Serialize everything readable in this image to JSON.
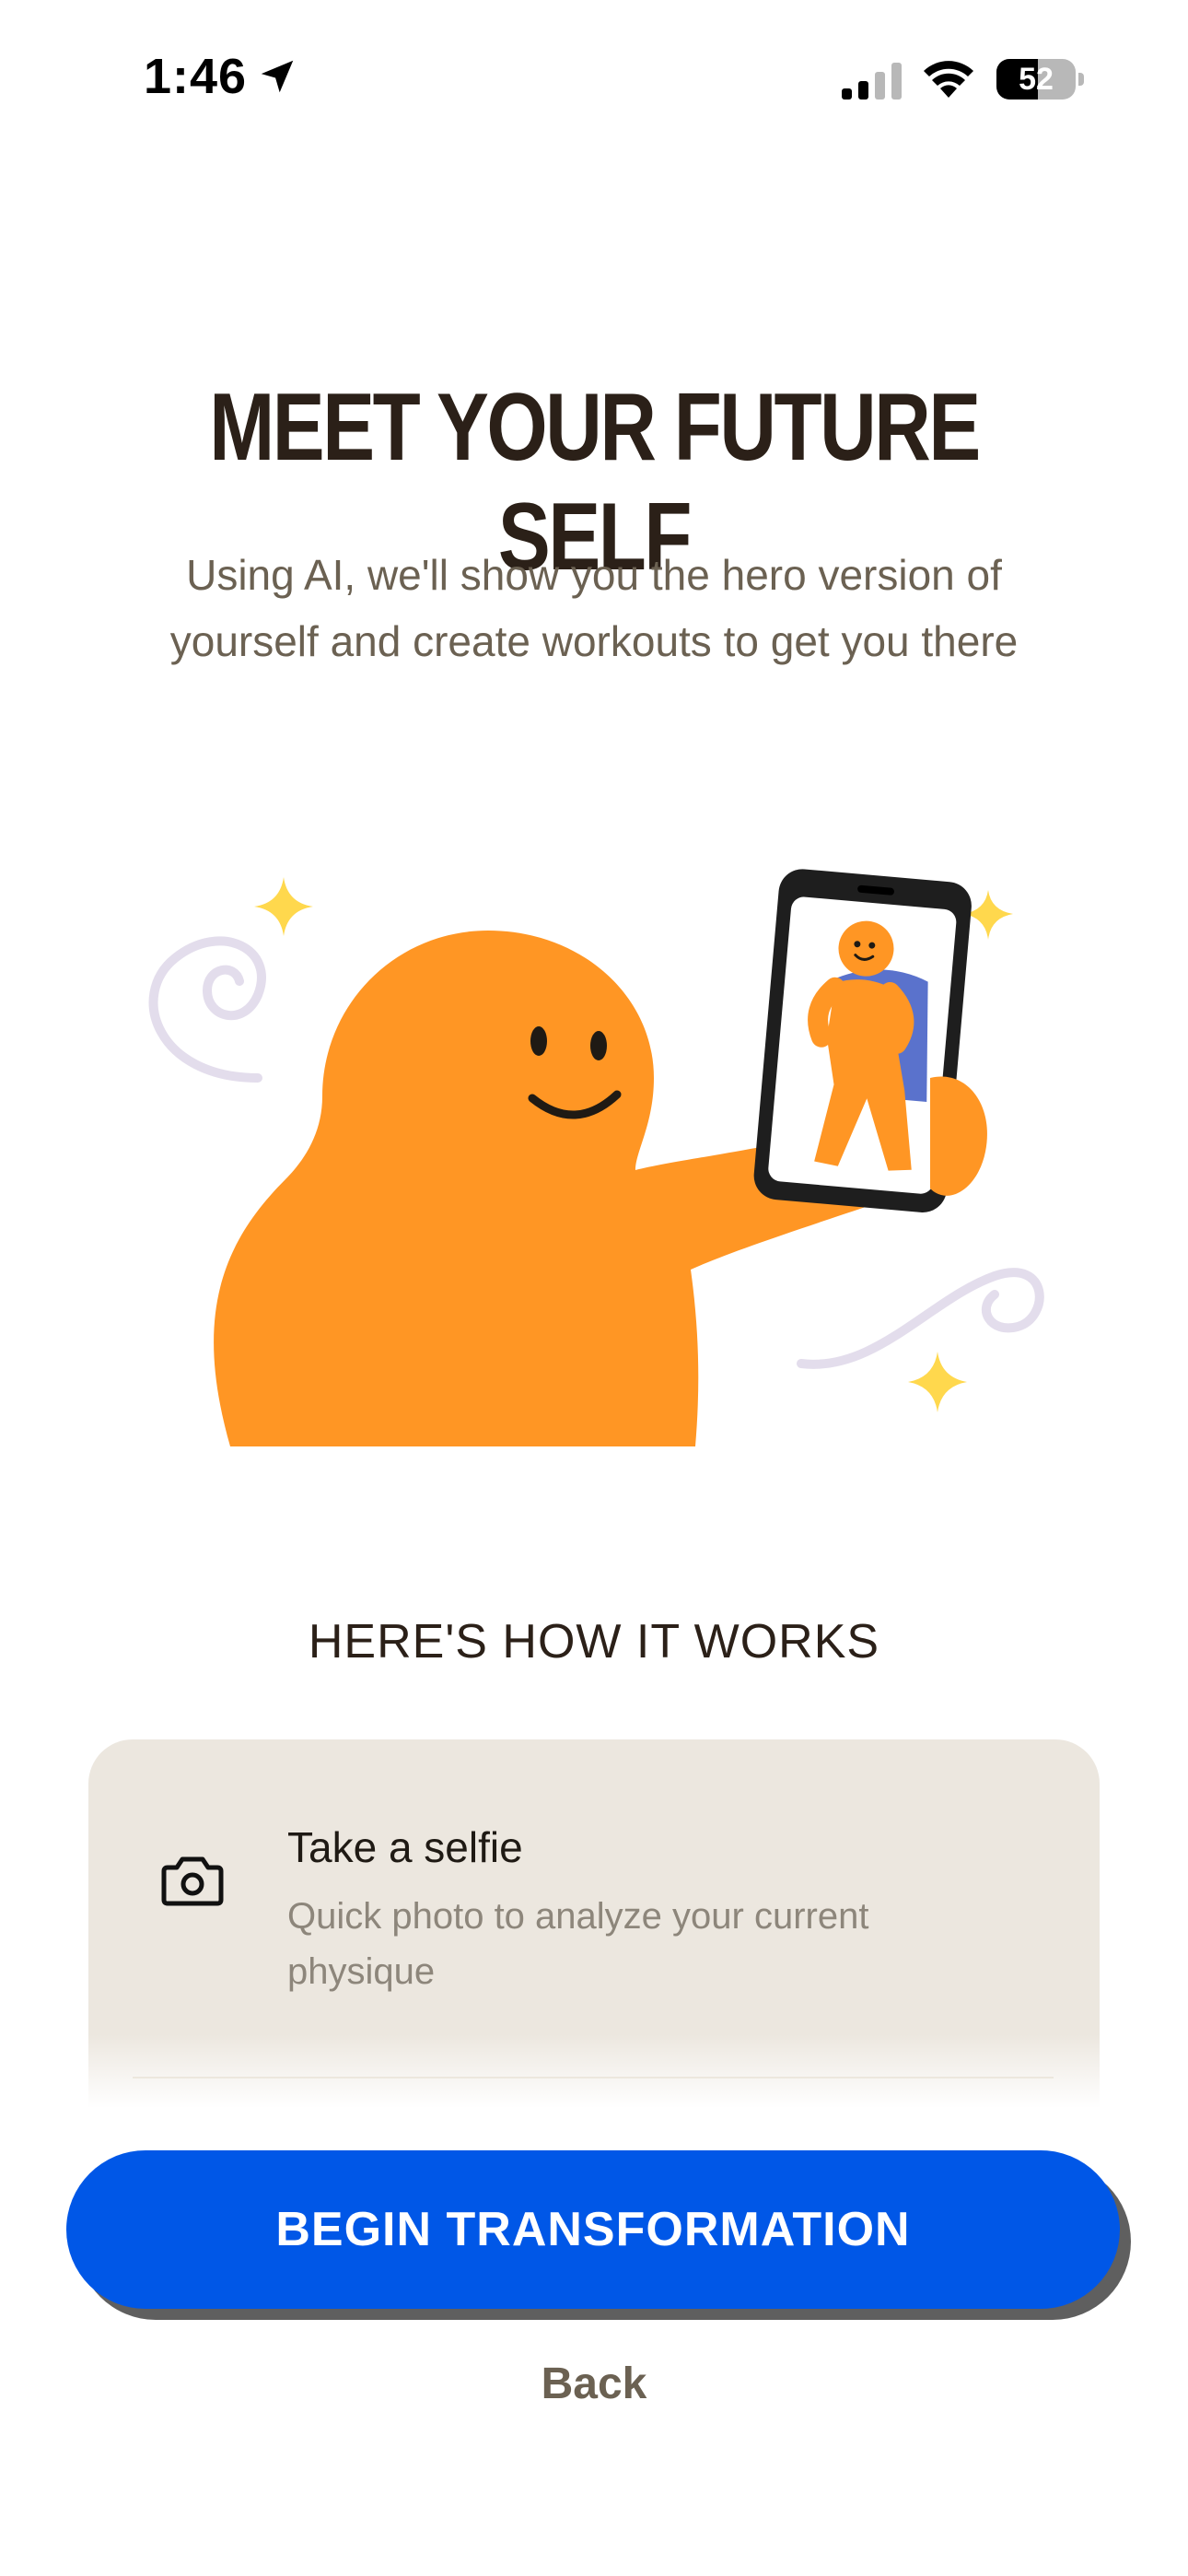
{
  "status_bar": {
    "time": "1:46",
    "battery_level": "52",
    "battery_fraction": 0.52,
    "icons": [
      "location-arrow-icon",
      "cellular-signal-icon",
      "wifi-icon",
      "battery-icon"
    ]
  },
  "header": {
    "title": "MEET YOUR FUTURE SELF",
    "subtitle": "Using AI, we'll show you the hero version of yourself and create workouts to get you there"
  },
  "illustration": {
    "name": "hero-selfie-illustration"
  },
  "how_it_works": {
    "heading": "HERE'S HOW IT WORKS",
    "steps": [
      {
        "icon": "camera-icon",
        "title": "Take a selfie",
        "description": "Quick photo to analyze your current physique"
      }
    ]
  },
  "actions": {
    "primary_label": "BEGIN TRANSFORMATION",
    "secondary_label": "Back"
  },
  "colors": {
    "primary": "#0057e7",
    "mascot": "#ff9624",
    "card_bg": "#ece7df",
    "title_text": "#2b2018",
    "muted_text": "#6b6152",
    "sparkle": "#ffd84d",
    "cape": "#5a72cc"
  }
}
